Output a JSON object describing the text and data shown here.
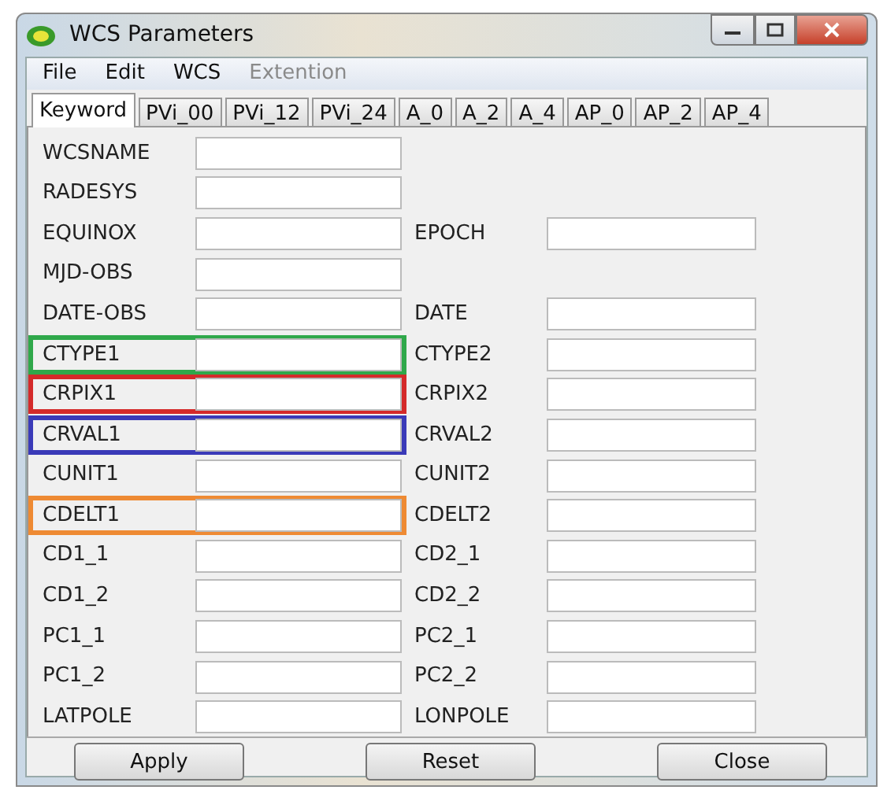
{
  "window": {
    "title": "WCS Parameters"
  },
  "menu": [
    {
      "label": "File",
      "disabled": false
    },
    {
      "label": "Edit",
      "disabled": false
    },
    {
      "label": "WCS",
      "disabled": false
    },
    {
      "label": "Extention",
      "disabled": true
    }
  ],
  "tabs": [
    {
      "label": "Keyword",
      "selected": true
    },
    {
      "label": "PVi_00",
      "selected": false
    },
    {
      "label": "PVi_12",
      "selected": false
    },
    {
      "label": "PVi_24",
      "selected": false
    },
    {
      "label": "A_0",
      "selected": false
    },
    {
      "label": "A_2",
      "selected": false
    },
    {
      "label": "A_4",
      "selected": false
    },
    {
      "label": "AP_0",
      "selected": false
    },
    {
      "label": "AP_2",
      "selected": false
    },
    {
      "label": "AP_4",
      "selected": false
    }
  ],
  "rows": [
    {
      "left": {
        "label": "WCSNAME"
      }
    },
    {
      "left": {
        "label": "RADESYS"
      }
    },
    {
      "left": {
        "label": "EQUINOX"
      },
      "right": {
        "label": "EPOCH"
      }
    },
    {
      "left": {
        "label": "MJD-OBS"
      }
    },
    {
      "left": {
        "label": "DATE-OBS"
      },
      "right": {
        "label": "DATE"
      }
    },
    {
      "left": {
        "label": "CTYPE1",
        "color": "#2fa84a"
      },
      "right": {
        "label": "CTYPE2"
      }
    },
    {
      "left": {
        "label": "CRPIX1",
        "color": "#d42a2a"
      },
      "right": {
        "label": "CRPIX2"
      }
    },
    {
      "left": {
        "label": "CRVAL1",
        "color": "#3a3ab8"
      },
      "right": {
        "label": "CRVAL2"
      }
    },
    {
      "left": {
        "label": "CUNIT1"
      },
      "right": {
        "label": "CUNIT2"
      }
    },
    {
      "left": {
        "label": "CDELT1",
        "color": "#ee8a33"
      },
      "right": {
        "label": "CDELT2"
      }
    },
    {
      "left": {
        "label": "CD1_1"
      },
      "right": {
        "label": "CD2_1"
      }
    },
    {
      "left": {
        "label": "CD1_2"
      },
      "right": {
        "label": "CD2_2"
      }
    },
    {
      "left": {
        "label": "PC1_1"
      },
      "right": {
        "label": "PC2_1"
      }
    },
    {
      "left": {
        "label": "PC1_2"
      },
      "right": {
        "label": "PC2_2"
      }
    },
    {
      "left": {
        "label": "LATPOLE"
      },
      "right": {
        "label": "LONPOLE"
      }
    }
  ],
  "buttons": [
    "Apply",
    "Reset",
    "Close"
  ]
}
